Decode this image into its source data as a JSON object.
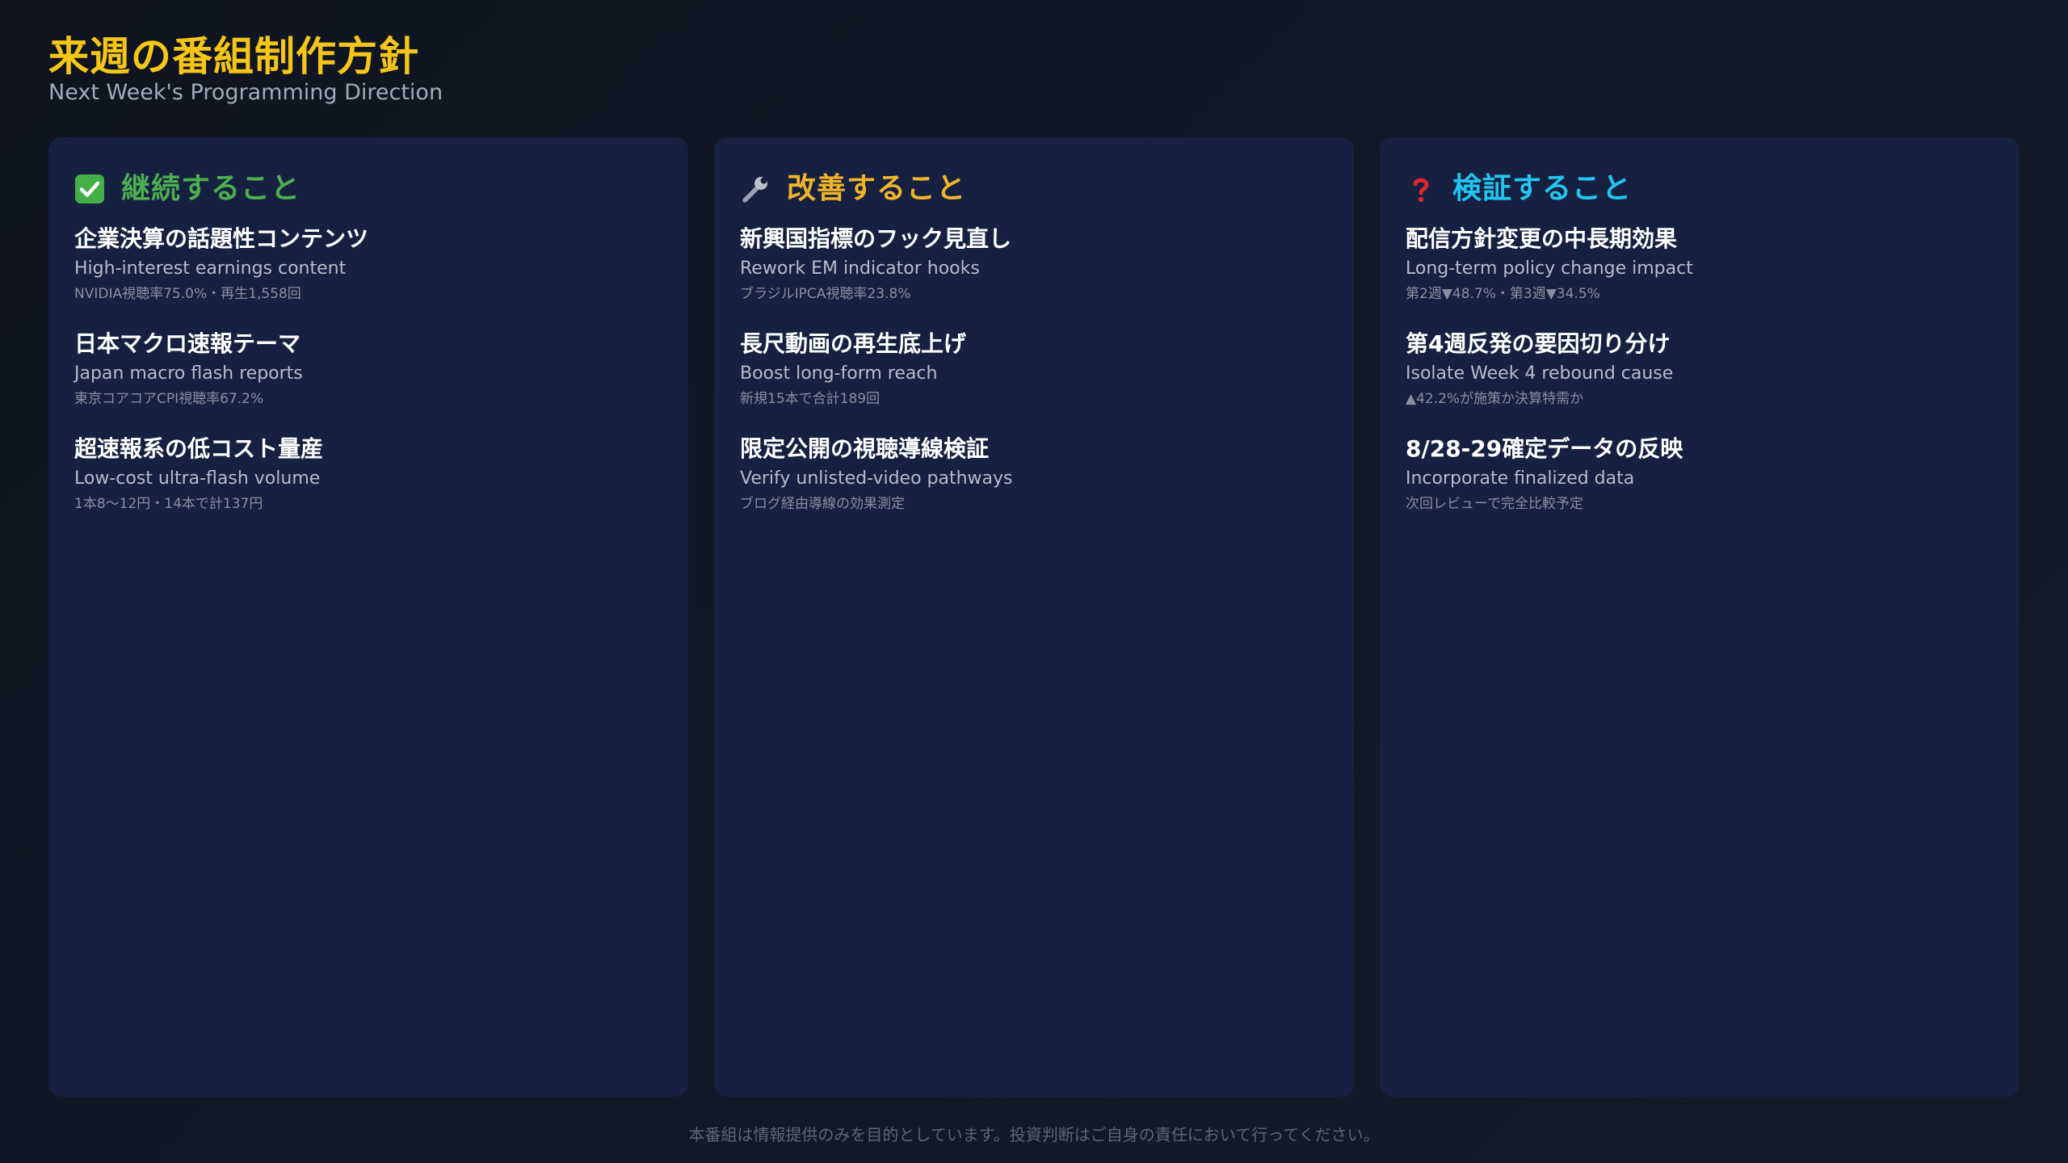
{
  "header": {
    "title": "来週の番組制作方針",
    "subtitle": "Next Week's Programming Direction"
  },
  "columns": [
    {
      "title": "継続すること",
      "icon": "check-icon",
      "color": "#4caf50",
      "items": [
        {
          "title": "企業決算の話題性コンテンツ",
          "subtitle": "High-interest earnings content",
          "detail": "NVIDIA視聴率75.0%・再生1,558回"
        },
        {
          "title": "日本マクロ速報テーマ",
          "subtitle": "Japan macro flash reports",
          "detail": "東京コアコアCPI視聴率67.2%"
        },
        {
          "title": "超速報系の低コスト量産",
          "subtitle": "Low-cost ultra-flash volume",
          "detail": "1本8〜12円・14本で計137円"
        }
      ]
    },
    {
      "title": "改善すること",
      "icon": "wrench-icon",
      "color": "#f0b429",
      "items": [
        {
          "title": "新興国指標のフック見直し",
          "subtitle": "Rework EM indicator hooks",
          "detail": "ブラジルIPCA視聴率23.8%"
        },
        {
          "title": "長尺動画の再生底上げ",
          "subtitle": "Boost long-form reach",
          "detail": "新規15本で合計189回"
        },
        {
          "title": "限定公開の視聴導線検証",
          "subtitle": "Verify unlisted-video pathways",
          "detail": "ブログ経由導線の効果測定"
        }
      ]
    },
    {
      "title": "検証すること",
      "icon": "question-icon",
      "color": "#22c5f0",
      "items": [
        {
          "title": "配信方針変更の中長期効果",
          "subtitle": "Long-term policy change impact",
          "detail": "第2週▼48.7%・第3週▼34.5%"
        },
        {
          "title": "第4週反発の要因切り分け",
          "subtitle": "Isolate Week 4 rebound cause",
          "detail": "▲42.2%が施策か決算特需か"
        },
        {
          "title": "8/28-29確定データの反映",
          "subtitle": "Incorporate finalized data",
          "detail": "次回レビューで完全比較予定"
        }
      ]
    }
  ],
  "footer": {
    "disclaimer": "本番組は情報提供のみを目的としています。投資判断はご自身の責任において行ってください。"
  }
}
